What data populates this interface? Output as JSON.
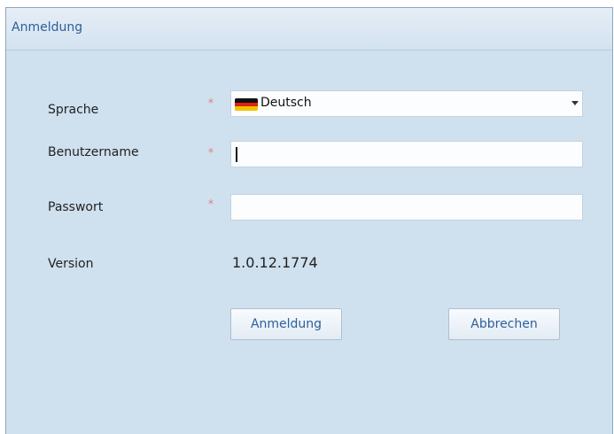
{
  "window": {
    "title": "Anmeldung"
  },
  "form": {
    "language_label": "Sprache",
    "language_value": "Deutsch",
    "username_label": "Benutzername",
    "username_value": "",
    "password_label": "Passwort",
    "password_value": "",
    "required_marker": "*",
    "version_label": "Version",
    "version_value": "1.0.12.1774"
  },
  "buttons": {
    "login": "Anmeldung",
    "cancel": "Abbrechen"
  },
  "icons": {
    "flag": "germany-flag-icon",
    "dropdown": "chevron-down-icon"
  }
}
